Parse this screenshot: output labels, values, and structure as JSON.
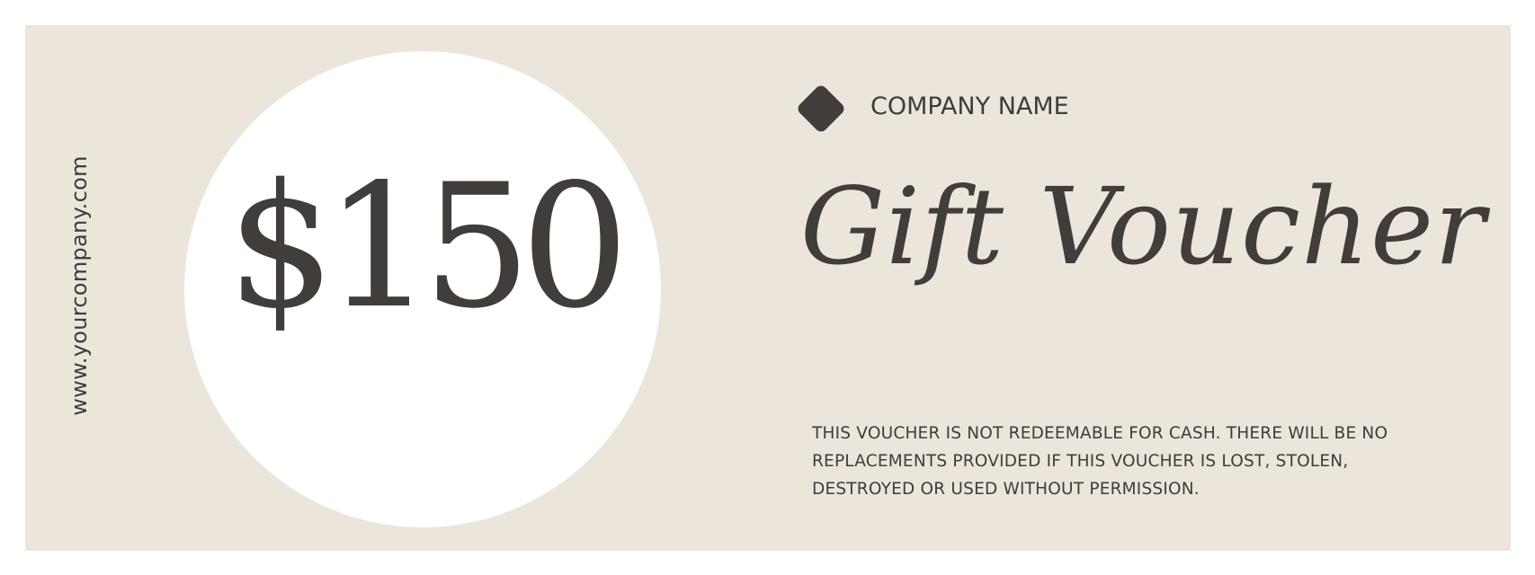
{
  "voucher": {
    "website": "www.yourcompany.com",
    "amount": "$150",
    "company_name": "COMPANY NAME",
    "title": "Gift Voucher",
    "terms": "THIS VOUCHER IS NOT REDEEMABLE FOR CASH. THERE WILL BE NO REPLACEMENTS PROVIDED IF THIS VOUCHER IS LOST, STOLEN, DESTROYED OR USED WITHOUT PERMISSION.",
    "logo_icon": "diamond-logo-icon"
  },
  "colors": {
    "background": "#ece5dc",
    "circle": "#ffffff",
    "text": "#403d3b"
  }
}
